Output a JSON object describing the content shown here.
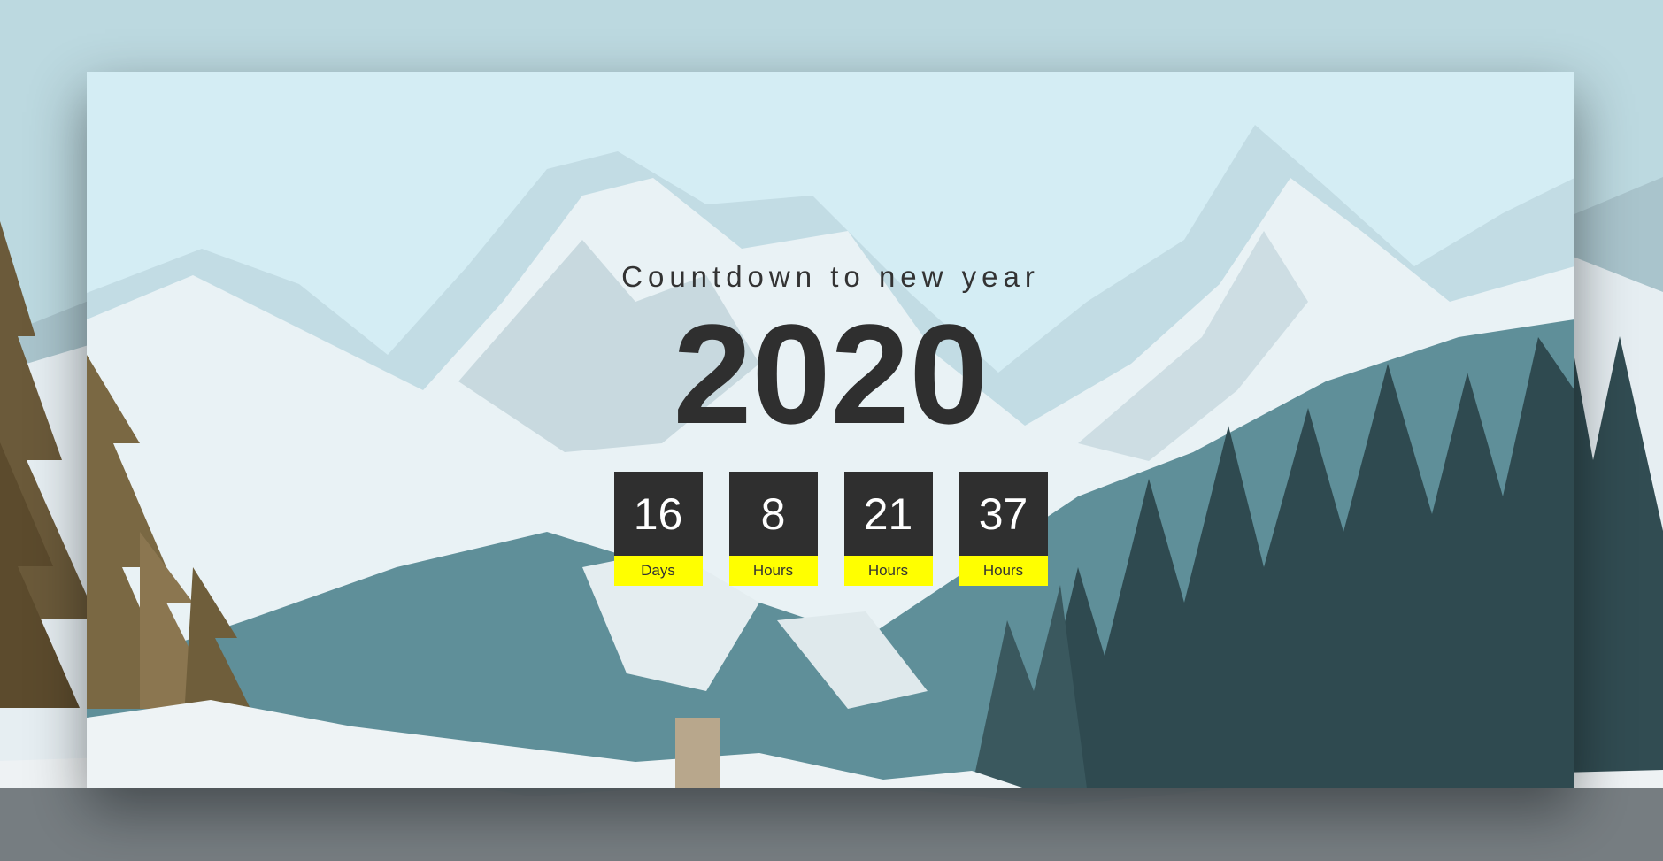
{
  "page": {
    "subtitle": "Countdown to new year",
    "year": "2020"
  },
  "countdown": [
    {
      "value": "16",
      "label": "Days"
    },
    {
      "value": "8",
      "label": "Hours"
    },
    {
      "value": "21",
      "label": "Hours"
    },
    {
      "value": "37",
      "label": "Hours"
    }
  ],
  "colors": {
    "tile_bg": "#2f2f2f",
    "label_bg": "#ffff00",
    "text_dark": "#333333"
  }
}
